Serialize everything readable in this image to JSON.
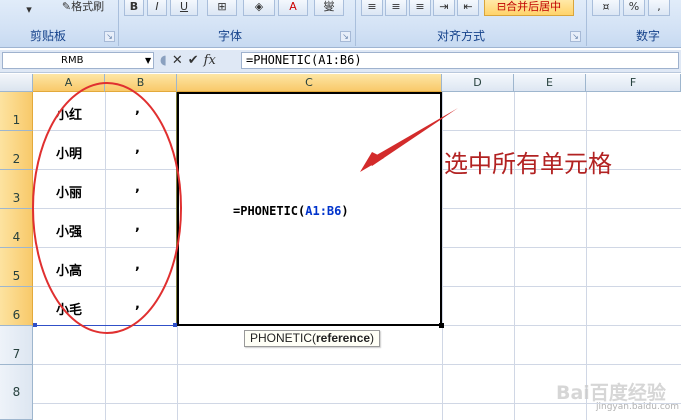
{
  "ribbon": {
    "clipboard": {
      "format_painter_label": "格式刷",
      "group_label": "剪贴板"
    },
    "font": {
      "bold": "B",
      "italic": "I",
      "underline": "U",
      "font_color": "A",
      "phonetic": "燮",
      "group_label": "字体"
    },
    "alignment": {
      "merge_center_label": "合并后居中",
      "group_label": "对齐方式"
    },
    "number": {
      "percent": "%",
      "comma": ",",
      "group_label": "数字"
    }
  },
  "formula_bar": {
    "name_box": "RMB",
    "formula": "=PHONETIC(A1:B6)",
    "icons": [
      "cancel-icon",
      "enter-icon",
      "function-icon"
    ]
  },
  "sheet": {
    "columns": [
      "A",
      "B",
      "C",
      "D",
      "E",
      "F"
    ],
    "rows": [
      "1",
      "2",
      "3",
      "4",
      "5",
      "6",
      "7",
      "8"
    ],
    "colA": [
      "小红",
      "小明",
      "小丽",
      "小强",
      "小高",
      "小毛"
    ],
    "colB": [
      ",",
      ",",
      ",",
      ",",
      ",",
      ","
    ],
    "merged_cell": {
      "prefix": "=PHONETIC(",
      "range": "A1:B6",
      "suffix": ")"
    },
    "tooltip": {
      "func": "PHONETIC(",
      "arg": "reference",
      "close": ")"
    }
  },
  "annotation": {
    "text": "选中所有单元格",
    "color": "#b22222"
  },
  "watermark": {
    "main": "Bai百度经验",
    "sub": "jingyan.baidu.com"
  },
  "colors": {
    "accent_ribbon": "#15428b",
    "selection_header": "#f9c96a",
    "formula_ref": "#0033cc"
  }
}
